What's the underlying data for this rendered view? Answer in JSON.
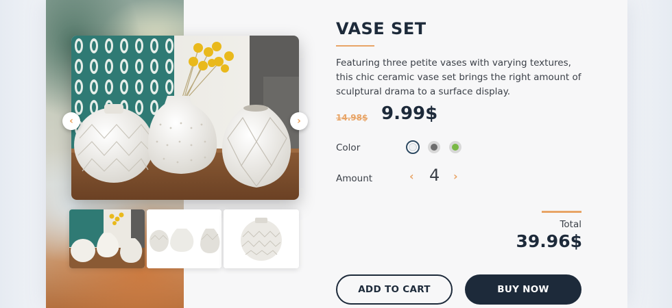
{
  "product": {
    "title": "VASE SET",
    "description": "Featuring three petite vases with varying textures, this chic ceramic vase set brings the right amount of sculptural drama to a surface display.",
    "old_price": "14.98$",
    "new_price": "9.99$"
  },
  "options": {
    "color_label": "Color",
    "colors": [
      "#eef1f4",
      "#6d6d6d",
      "#79b845"
    ],
    "selected_color_index": 0,
    "amount_label": "Amount",
    "amount": "4"
  },
  "gallery": {
    "prev_icon": "chevron-left-icon",
    "next_icon": "chevron-right-icon",
    "thumbnail_count": 3
  },
  "summary": {
    "total_label": "Total",
    "total_value": "39.96$"
  },
  "actions": {
    "add_to_cart": "ADD TO CART",
    "buy_now": "BUY NOW"
  },
  "colors": {
    "accent": "#e8a466",
    "primary": "#1d2a3a"
  }
}
